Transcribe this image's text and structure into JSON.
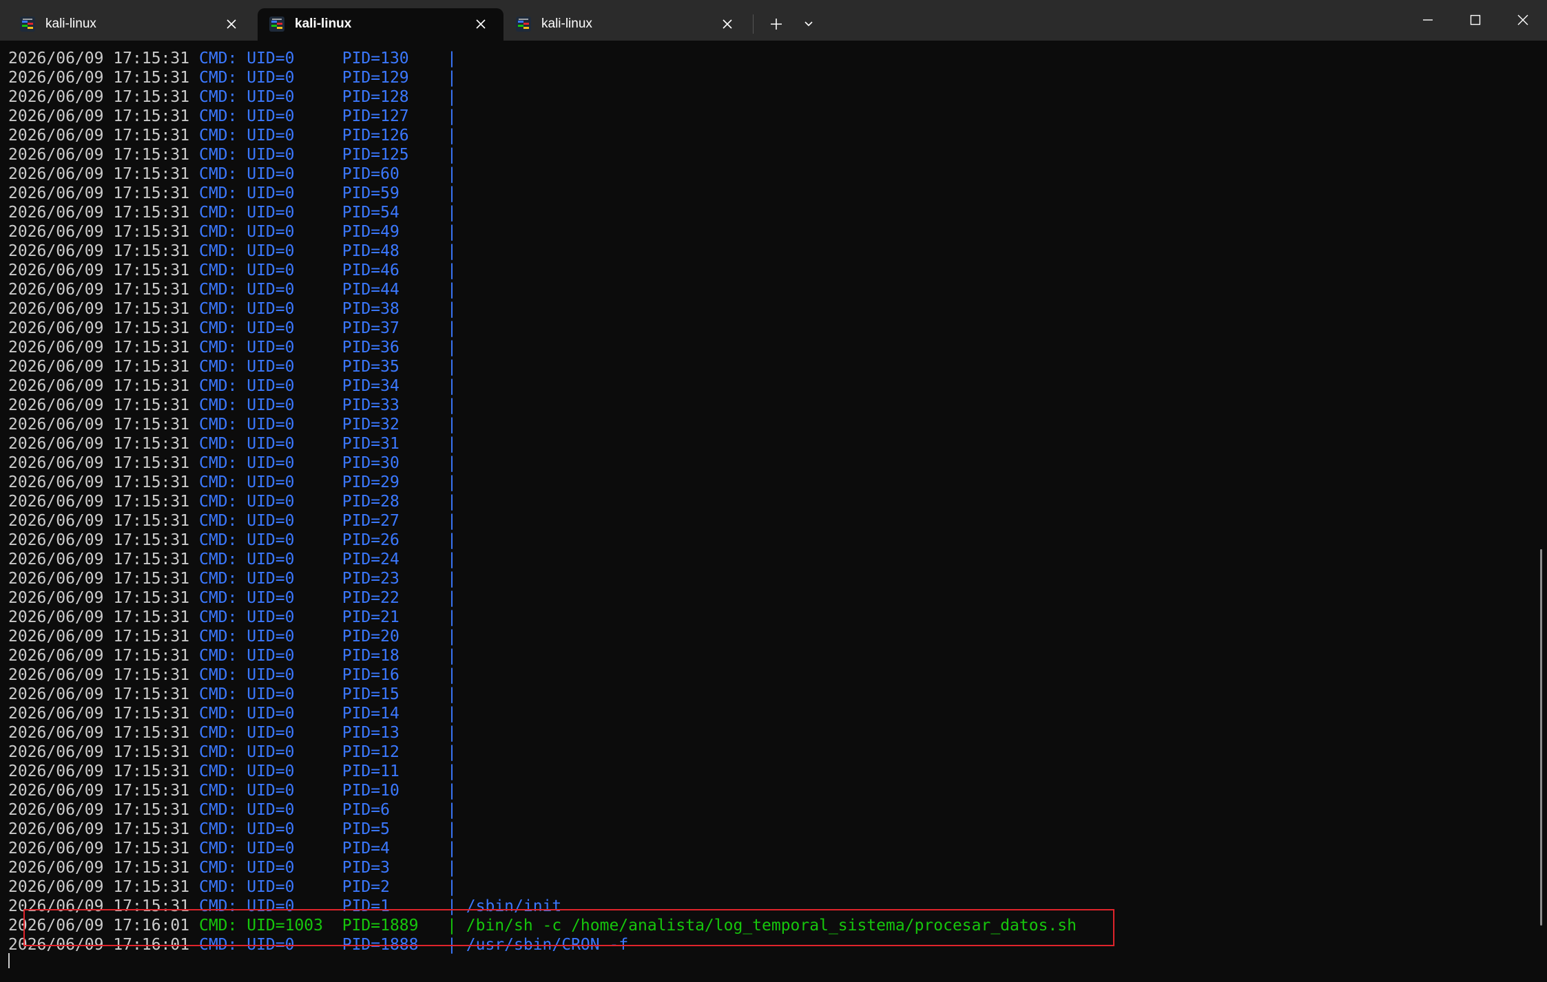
{
  "tabs": [
    {
      "label": "kali-linux",
      "active": false
    },
    {
      "label": "kali-linux",
      "active": true
    },
    {
      "label": "kali-linux",
      "active": false
    }
  ],
  "icons": {
    "tab": "kali-linux-icon",
    "close": "close-icon",
    "new_tab": "plus-icon",
    "dropdown": "chevron-down-icon",
    "minimize": "minimize-icon",
    "maximize": "maximize-icon",
    "window_close": "close-icon"
  },
  "colors": {
    "background": "#0c0c0c",
    "titlebar": "#2b2b2b",
    "timestamp": "#cccccc",
    "uid0": "#3b78ff",
    "uid_user": "#16c60c",
    "highlight": "#e0242b"
  },
  "scrollbar": {
    "thumb_start_fraction": 0.54,
    "thumb_length_fraction": 0.4
  },
  "terminal": {
    "lines": [
      {
        "ts": "2026/06/09 17:15:31",
        "cmd": "CMD:",
        "uid": "UID=0",
        "pid": "PID=130",
        "sep": "|",
        "command": "",
        "highlight": false
      },
      {
        "ts": "2026/06/09 17:15:31",
        "cmd": "CMD:",
        "uid": "UID=0",
        "pid": "PID=129",
        "sep": "|",
        "command": "",
        "highlight": false
      },
      {
        "ts": "2026/06/09 17:15:31",
        "cmd": "CMD:",
        "uid": "UID=0",
        "pid": "PID=128",
        "sep": "|",
        "command": "",
        "highlight": false
      },
      {
        "ts": "2026/06/09 17:15:31",
        "cmd": "CMD:",
        "uid": "UID=0",
        "pid": "PID=127",
        "sep": "|",
        "command": "",
        "highlight": false
      },
      {
        "ts": "2026/06/09 17:15:31",
        "cmd": "CMD:",
        "uid": "UID=0",
        "pid": "PID=126",
        "sep": "|",
        "command": "",
        "highlight": false
      },
      {
        "ts": "2026/06/09 17:15:31",
        "cmd": "CMD:",
        "uid": "UID=0",
        "pid": "PID=125",
        "sep": "|",
        "command": "",
        "highlight": false
      },
      {
        "ts": "2026/06/09 17:15:31",
        "cmd": "CMD:",
        "uid": "UID=0",
        "pid": "PID=60",
        "sep": "|",
        "command": "",
        "highlight": false
      },
      {
        "ts": "2026/06/09 17:15:31",
        "cmd": "CMD:",
        "uid": "UID=0",
        "pid": "PID=59",
        "sep": "|",
        "command": "",
        "highlight": false
      },
      {
        "ts": "2026/06/09 17:15:31",
        "cmd": "CMD:",
        "uid": "UID=0",
        "pid": "PID=54",
        "sep": "|",
        "command": "",
        "highlight": false
      },
      {
        "ts": "2026/06/09 17:15:31",
        "cmd": "CMD:",
        "uid": "UID=0",
        "pid": "PID=49",
        "sep": "|",
        "command": "",
        "highlight": false
      },
      {
        "ts": "2026/06/09 17:15:31",
        "cmd": "CMD:",
        "uid": "UID=0",
        "pid": "PID=48",
        "sep": "|",
        "command": "",
        "highlight": false
      },
      {
        "ts": "2026/06/09 17:15:31",
        "cmd": "CMD:",
        "uid": "UID=0",
        "pid": "PID=46",
        "sep": "|",
        "command": "",
        "highlight": false
      },
      {
        "ts": "2026/06/09 17:15:31",
        "cmd": "CMD:",
        "uid": "UID=0",
        "pid": "PID=44",
        "sep": "|",
        "command": "",
        "highlight": false
      },
      {
        "ts": "2026/06/09 17:15:31",
        "cmd": "CMD:",
        "uid": "UID=0",
        "pid": "PID=38",
        "sep": "|",
        "command": "",
        "highlight": false
      },
      {
        "ts": "2026/06/09 17:15:31",
        "cmd": "CMD:",
        "uid": "UID=0",
        "pid": "PID=37",
        "sep": "|",
        "command": "",
        "highlight": false
      },
      {
        "ts": "2026/06/09 17:15:31",
        "cmd": "CMD:",
        "uid": "UID=0",
        "pid": "PID=36",
        "sep": "|",
        "command": "",
        "highlight": false
      },
      {
        "ts": "2026/06/09 17:15:31",
        "cmd": "CMD:",
        "uid": "UID=0",
        "pid": "PID=35",
        "sep": "|",
        "command": "",
        "highlight": false
      },
      {
        "ts": "2026/06/09 17:15:31",
        "cmd": "CMD:",
        "uid": "UID=0",
        "pid": "PID=34",
        "sep": "|",
        "command": "",
        "highlight": false
      },
      {
        "ts": "2026/06/09 17:15:31",
        "cmd": "CMD:",
        "uid": "UID=0",
        "pid": "PID=33",
        "sep": "|",
        "command": "",
        "highlight": false
      },
      {
        "ts": "2026/06/09 17:15:31",
        "cmd": "CMD:",
        "uid": "UID=0",
        "pid": "PID=32",
        "sep": "|",
        "command": "",
        "highlight": false
      },
      {
        "ts": "2026/06/09 17:15:31",
        "cmd": "CMD:",
        "uid": "UID=0",
        "pid": "PID=31",
        "sep": "|",
        "command": "",
        "highlight": false
      },
      {
        "ts": "2026/06/09 17:15:31",
        "cmd": "CMD:",
        "uid": "UID=0",
        "pid": "PID=30",
        "sep": "|",
        "command": "",
        "highlight": false
      },
      {
        "ts": "2026/06/09 17:15:31",
        "cmd": "CMD:",
        "uid": "UID=0",
        "pid": "PID=29",
        "sep": "|",
        "command": "",
        "highlight": false
      },
      {
        "ts": "2026/06/09 17:15:31",
        "cmd": "CMD:",
        "uid": "UID=0",
        "pid": "PID=28",
        "sep": "|",
        "command": "",
        "highlight": false
      },
      {
        "ts": "2026/06/09 17:15:31",
        "cmd": "CMD:",
        "uid": "UID=0",
        "pid": "PID=27",
        "sep": "|",
        "command": "",
        "highlight": false
      },
      {
        "ts": "2026/06/09 17:15:31",
        "cmd": "CMD:",
        "uid": "UID=0",
        "pid": "PID=26",
        "sep": "|",
        "command": "",
        "highlight": false
      },
      {
        "ts": "2026/06/09 17:15:31",
        "cmd": "CMD:",
        "uid": "UID=0",
        "pid": "PID=24",
        "sep": "|",
        "command": "",
        "highlight": false
      },
      {
        "ts": "2026/06/09 17:15:31",
        "cmd": "CMD:",
        "uid": "UID=0",
        "pid": "PID=23",
        "sep": "|",
        "command": "",
        "highlight": false
      },
      {
        "ts": "2026/06/09 17:15:31",
        "cmd": "CMD:",
        "uid": "UID=0",
        "pid": "PID=22",
        "sep": "|",
        "command": "",
        "highlight": false
      },
      {
        "ts": "2026/06/09 17:15:31",
        "cmd": "CMD:",
        "uid": "UID=0",
        "pid": "PID=21",
        "sep": "|",
        "command": "",
        "highlight": false
      },
      {
        "ts": "2026/06/09 17:15:31",
        "cmd": "CMD:",
        "uid": "UID=0",
        "pid": "PID=20",
        "sep": "|",
        "command": "",
        "highlight": false
      },
      {
        "ts": "2026/06/09 17:15:31",
        "cmd": "CMD:",
        "uid": "UID=0",
        "pid": "PID=18",
        "sep": "|",
        "command": "",
        "highlight": false
      },
      {
        "ts": "2026/06/09 17:15:31",
        "cmd": "CMD:",
        "uid": "UID=0",
        "pid": "PID=16",
        "sep": "|",
        "command": "",
        "highlight": false
      },
      {
        "ts": "2026/06/09 17:15:31",
        "cmd": "CMD:",
        "uid": "UID=0",
        "pid": "PID=15",
        "sep": "|",
        "command": "",
        "highlight": false
      },
      {
        "ts": "2026/06/09 17:15:31",
        "cmd": "CMD:",
        "uid": "UID=0",
        "pid": "PID=14",
        "sep": "|",
        "command": "",
        "highlight": false
      },
      {
        "ts": "2026/06/09 17:15:31",
        "cmd": "CMD:",
        "uid": "UID=0",
        "pid": "PID=13",
        "sep": "|",
        "command": "",
        "highlight": false
      },
      {
        "ts": "2026/06/09 17:15:31",
        "cmd": "CMD:",
        "uid": "UID=0",
        "pid": "PID=12",
        "sep": "|",
        "command": "",
        "highlight": false
      },
      {
        "ts": "2026/06/09 17:15:31",
        "cmd": "CMD:",
        "uid": "UID=0",
        "pid": "PID=11",
        "sep": "|",
        "command": "",
        "highlight": false
      },
      {
        "ts": "2026/06/09 17:15:31",
        "cmd": "CMD:",
        "uid": "UID=0",
        "pid": "PID=10",
        "sep": "|",
        "command": "",
        "highlight": false
      },
      {
        "ts": "2026/06/09 17:15:31",
        "cmd": "CMD:",
        "uid": "UID=0",
        "pid": "PID=6",
        "sep": "|",
        "command": "",
        "highlight": false
      },
      {
        "ts": "2026/06/09 17:15:31",
        "cmd": "CMD:",
        "uid": "UID=0",
        "pid": "PID=5",
        "sep": "|",
        "command": "",
        "highlight": false
      },
      {
        "ts": "2026/06/09 17:15:31",
        "cmd": "CMD:",
        "uid": "UID=0",
        "pid": "PID=4",
        "sep": "|",
        "command": "",
        "highlight": false
      },
      {
        "ts": "2026/06/09 17:15:31",
        "cmd": "CMD:",
        "uid": "UID=0",
        "pid": "PID=3",
        "sep": "|",
        "command": "",
        "highlight": false
      },
      {
        "ts": "2026/06/09 17:15:31",
        "cmd": "CMD:",
        "uid": "UID=0",
        "pid": "PID=2",
        "sep": "|",
        "command": "",
        "highlight": false
      },
      {
        "ts": "2026/06/09 17:15:31",
        "cmd": "CMD:",
        "uid": "UID=0",
        "pid": "PID=1",
        "sep": "|",
        "command": "/sbin/init",
        "highlight": false
      },
      {
        "ts": "2026/06/09 17:16:01",
        "cmd": "CMD:",
        "uid": "UID=1003",
        "pid": "PID=1889",
        "sep": "|",
        "command": "/bin/sh -c /home/analista/log_temporal_sistema/procesar_datos.sh",
        "highlight": true
      },
      {
        "ts": "2026/06/09 17:16:01",
        "cmd": "CMD:",
        "uid": "UID=0",
        "pid": "PID=1888",
        "sep": "|",
        "command": "/usr/sbin/CRON -f",
        "highlight": false
      }
    ]
  }
}
